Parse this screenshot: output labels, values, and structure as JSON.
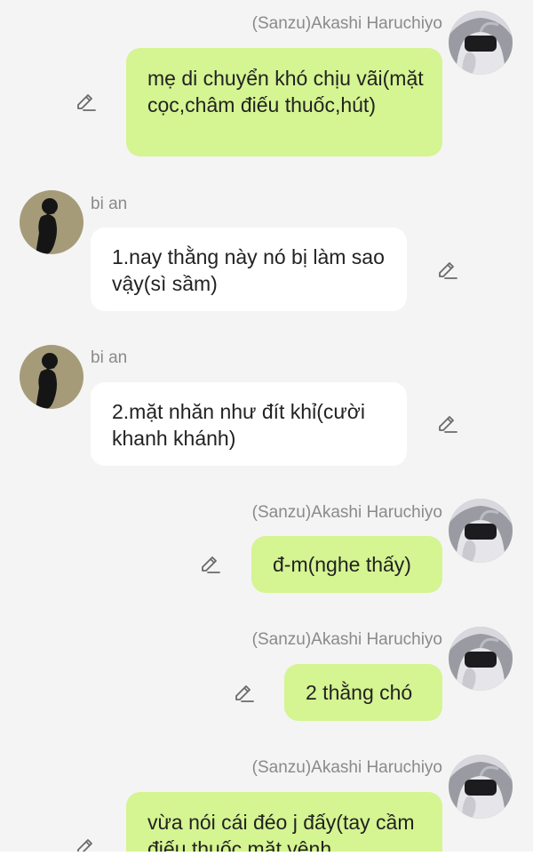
{
  "chat": {
    "messages": [
      {
        "sender": "(Sanzu)Akashi Haruchiyo",
        "text": "mẹ di chuyển khó chịu vãi(mặt cọc,châm điếu thuốc,hút)",
        "side": "right"
      },
      {
        "sender": "bi an",
        "text": "1.nay thằng này nó bị làm sao vậy(sì sầm)",
        "side": "left"
      },
      {
        "sender": "bi an",
        "text": "2.mặt nhăn như đít khỉ(cười khanh khánh)",
        "side": "left"
      },
      {
        "sender": "(Sanzu)Akashi Haruchiyo",
        "text": "đ-m(nghe thấy)",
        "side": "right"
      },
      {
        "sender": "(Sanzu)Akashi Haruchiyo",
        "text": "2 thằng chó",
        "side": "right"
      },
      {
        "sender": "(Sanzu)Akashi Haruchiyo",
        "text": "vừa nói cái đéo j đấy(tay cầm điếu thuốc,mặt vênh",
        "side": "right"
      }
    ]
  },
  "icons": {
    "edit": "pencil-edit-icon",
    "avatar_me": "masked-character-avatar",
    "avatar_other": "silhouette-avatar"
  },
  "colors": {
    "my_bubble": "#d5f492",
    "other_bubble": "#ffffff",
    "background": "#f4f4f4",
    "name_text": "#8a8a8a"
  }
}
